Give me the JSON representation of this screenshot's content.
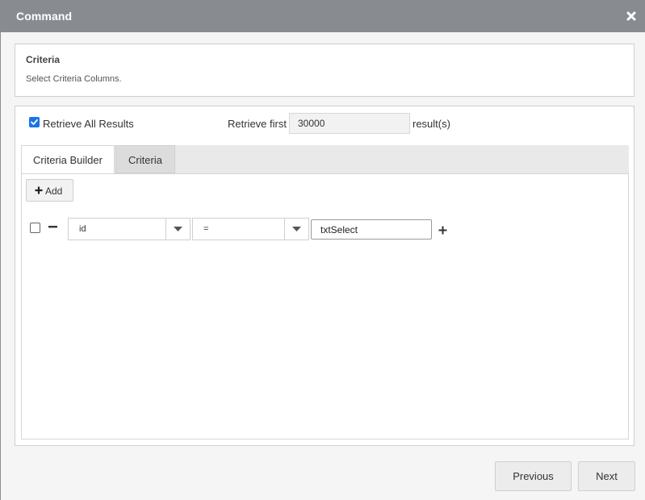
{
  "window": {
    "title": "Command"
  },
  "criteria_panel": {
    "title": "Criteria",
    "description": "Select Criteria Columns."
  },
  "retrieve": {
    "all_label": "Retrieve All Results",
    "all_checked": true,
    "first_label": "Retrieve first",
    "first_value": "30000",
    "results_label": "result(s)"
  },
  "tabs": [
    {
      "label": "Criteria Builder",
      "active": true
    },
    {
      "label": "Criteria",
      "active": false
    }
  ],
  "builder": {
    "add_label": "Add",
    "rows": [
      {
        "checked": false,
        "field": "id",
        "operator": "=",
        "value": "txtSelect"
      }
    ]
  },
  "footer": {
    "previous_label": "Previous",
    "next_label": "Next"
  },
  "colors": {
    "titlebar": "#888c91",
    "checkbox_accent": "#1a73e8",
    "panel_border": "#cfcfcf"
  },
  "icons": {
    "close": "close-icon",
    "add": "plus-icon",
    "remove_row": "minus-icon",
    "add_row": "plus-icon",
    "dropdown": "caret-down-icon",
    "check": "check-icon"
  }
}
